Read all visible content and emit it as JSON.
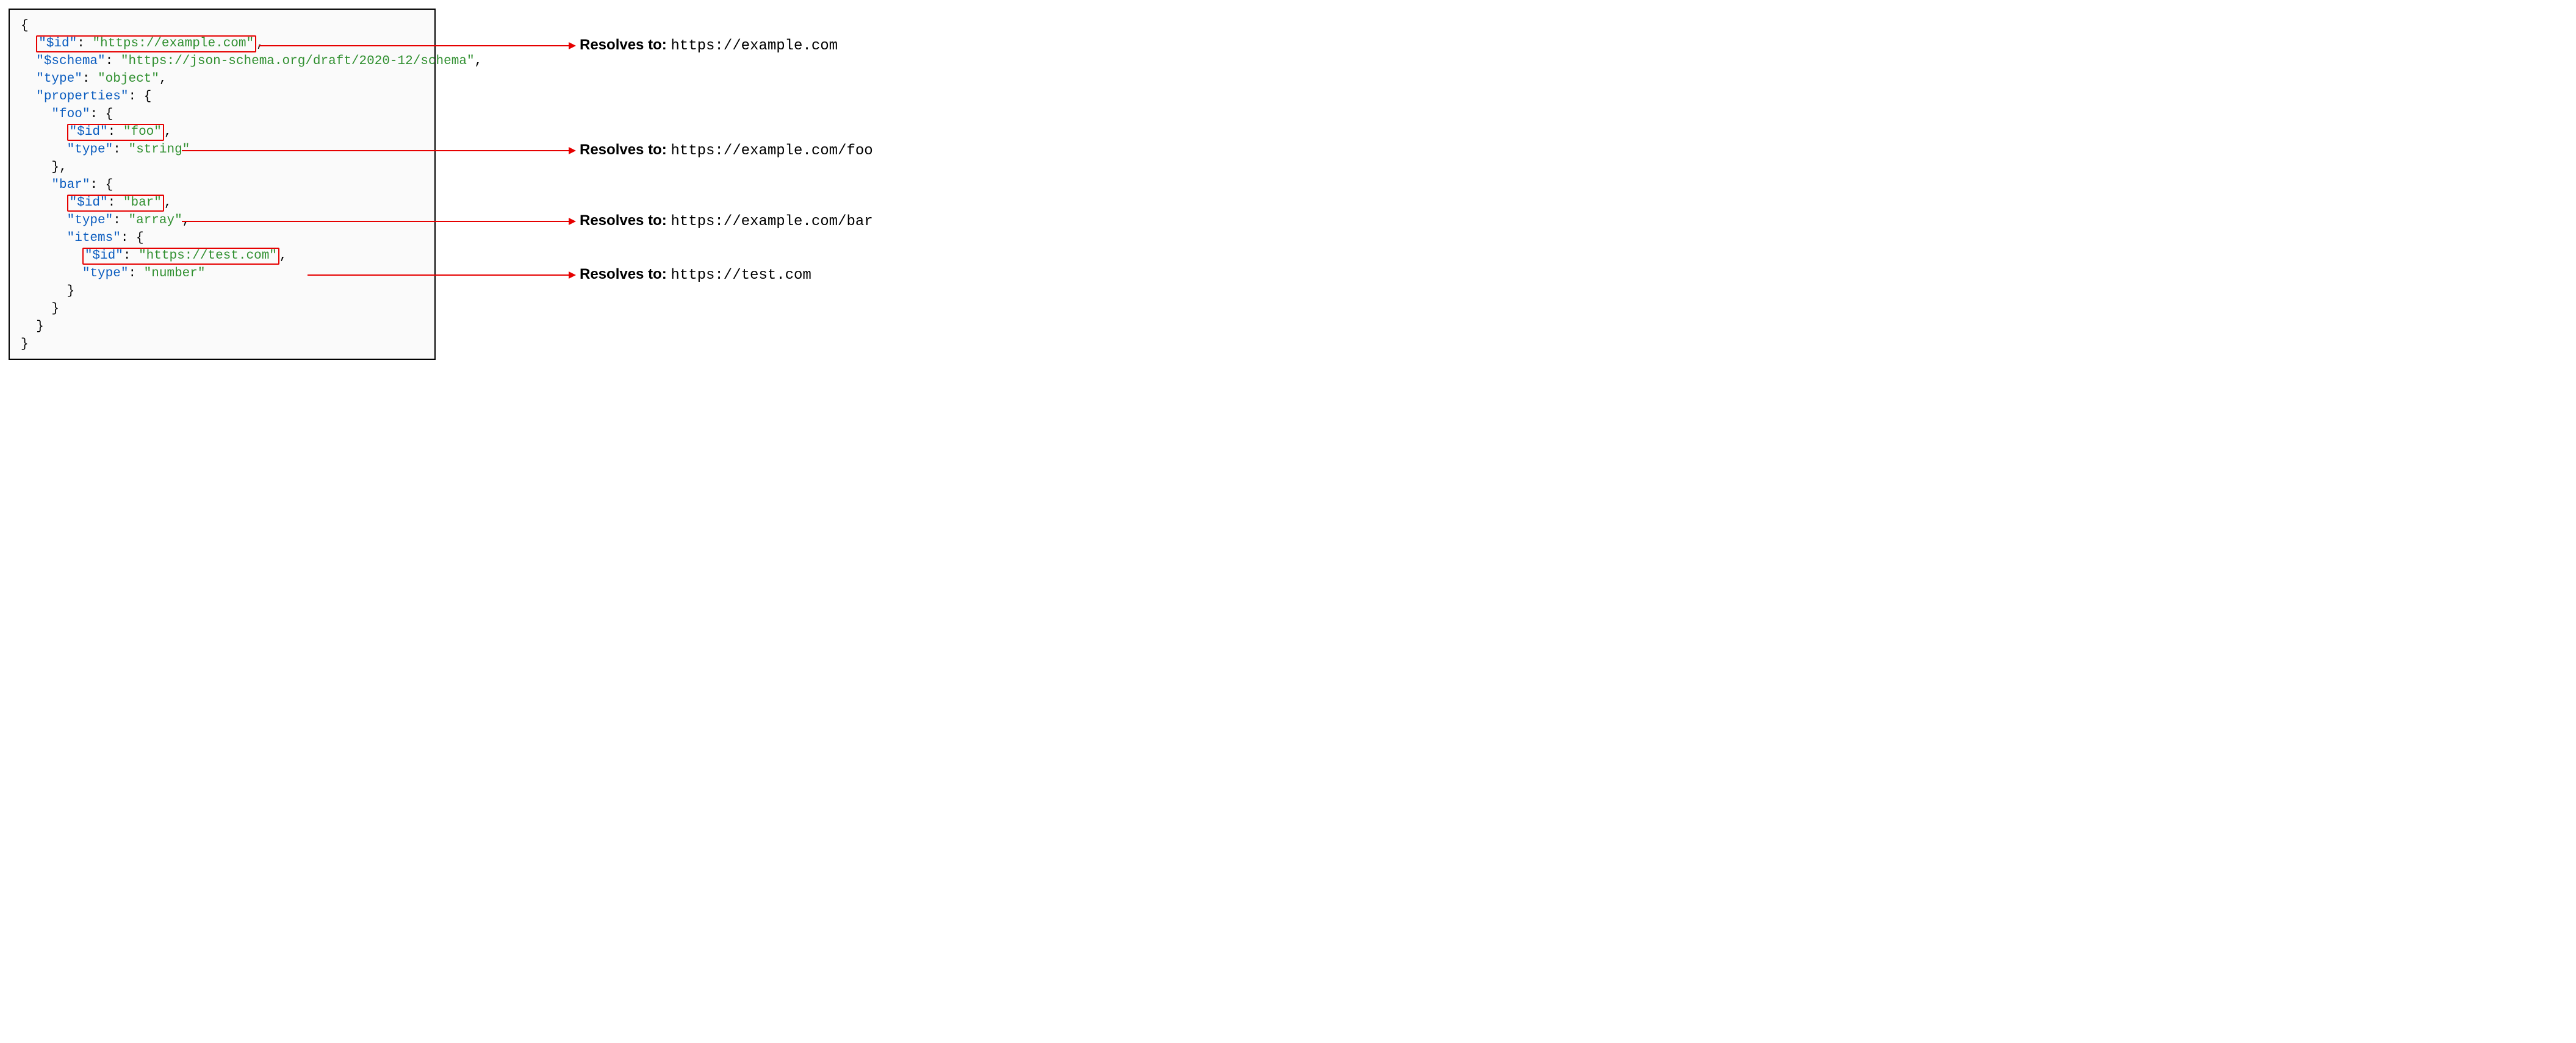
{
  "code": {
    "line1_open": "{",
    "id1_key": "\"$id\"",
    "id1_val": "\"https://example.com\"",
    "schema_key": "\"$schema\"",
    "schema_val": "\"https://json-schema.org/draft/2020-12/schema\"",
    "type_key": "\"type\"",
    "type_obj": "\"object\"",
    "props_key": "\"properties\"",
    "foo_key": "\"foo\"",
    "id2_key": "\"$id\"",
    "id2_val": "\"foo\"",
    "type_string": "\"string\"",
    "bar_key": "\"bar\"",
    "id3_key": "\"$id\"",
    "id3_val": "\"bar\"",
    "type_array": "\"array\"",
    "items_key": "\"items\"",
    "id4_key": "\"$id\"",
    "id4_val": "\"https://test.com\"",
    "type_number": "\"number\"",
    "close_brace": "}",
    "close_brace_comma": "},"
  },
  "callouts": {
    "label": "Resolves to:",
    "r1": "https://example.com",
    "r2": "https://example.com/foo",
    "r3": "https://example.com/bar",
    "r4": "https://test.com"
  }
}
